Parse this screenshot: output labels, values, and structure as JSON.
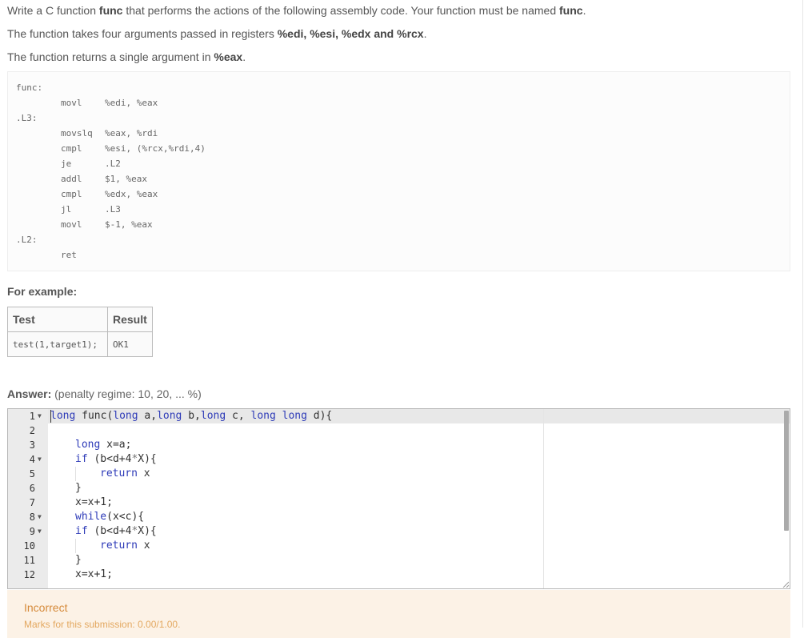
{
  "question": {
    "line1": [
      {
        "t": "Write a C function ",
        "b": false
      },
      {
        "t": "func",
        "b": true
      },
      {
        "t": " that performs the actions of the following assembly code. Your function must be named ",
        "b": false
      },
      {
        "t": "func",
        "b": true
      },
      {
        "t": ".",
        "b": false
      }
    ],
    "line2": [
      {
        "t": "The function takes four arguments passed in registers ",
        "b": false
      },
      {
        "t": "%edi, %esi, %edx and %rcx",
        "b": true
      },
      {
        "t": ".",
        "b": false
      }
    ],
    "line3": [
      {
        "t": "The function returns a single argument in ",
        "b": false
      },
      {
        "t": "%eax",
        "b": true
      },
      {
        "t": ".",
        "b": false
      }
    ]
  },
  "assembly": [
    {
      "label": "func:",
      "op": "",
      "arg": ""
    },
    {
      "label": "",
      "op": "movl",
      "arg": "%edi, %eax"
    },
    {
      "label": ".L3:",
      "op": "",
      "arg": ""
    },
    {
      "label": "",
      "op": "movslq",
      "arg": "%eax, %rdi"
    },
    {
      "label": "",
      "op": "cmpl",
      "arg": "%esi, (%rcx,%rdi,4)"
    },
    {
      "label": "",
      "op": "je",
      "arg": ".L2"
    },
    {
      "label": "",
      "op": "addl",
      "arg": "$1, %eax"
    },
    {
      "label": "",
      "op": "cmpl",
      "arg": "%edx, %eax"
    },
    {
      "label": "",
      "op": "jl",
      "arg": ".L3"
    },
    {
      "label": "",
      "op": "movl",
      "arg": "$-1, %eax"
    },
    {
      "label": ".L2:",
      "op": "",
      "arg": ""
    },
    {
      "label": "",
      "op": "ret",
      "arg": ""
    }
  ],
  "example": {
    "title": "For example:",
    "headers": [
      "Test",
      "Result"
    ],
    "rows": [
      [
        "test(1,target1);",
        "OK1"
      ]
    ]
  },
  "answer": {
    "label": "Answer:",
    "penalty": "(penalty regime: 10, 20, ... %)"
  },
  "editor": {
    "lines": [
      {
        "n": "1",
        "fold": true,
        "indent": 0,
        "tokens": [
          [
            "kw",
            "long"
          ],
          [
            "p",
            " func("
          ],
          [
            "kw",
            "long"
          ],
          [
            "p",
            " a,"
          ],
          [
            "kw",
            "long"
          ],
          [
            "p",
            " b,"
          ],
          [
            "kw",
            "long"
          ],
          [
            "p",
            " c, "
          ],
          [
            "kw",
            "long long"
          ],
          [
            "p",
            " d){"
          ]
        ]
      },
      {
        "n": "2",
        "fold": false,
        "indent": 0,
        "tokens": []
      },
      {
        "n": "3",
        "fold": false,
        "indent": 1,
        "tokens": [
          [
            "kw",
            "long"
          ],
          [
            "p",
            " x=a;"
          ]
        ]
      },
      {
        "n": "4",
        "fold": true,
        "indent": 1,
        "tokens": [
          [
            "kw",
            "if"
          ],
          [
            "p",
            " (b<d+4"
          ],
          [
            "op",
            "*"
          ],
          [
            "p",
            "X){"
          ]
        ]
      },
      {
        "n": "5",
        "fold": false,
        "indent": 2,
        "tokens": [
          [
            "kw",
            "return"
          ],
          [
            "p",
            " x"
          ]
        ]
      },
      {
        "n": "6",
        "fold": false,
        "indent": 1,
        "tokens": [
          [
            "p",
            "}"
          ]
        ]
      },
      {
        "n": "7",
        "fold": false,
        "indent": 1,
        "tokens": [
          [
            "p",
            "x=x+1;"
          ]
        ]
      },
      {
        "n": "8",
        "fold": true,
        "indent": 1,
        "tokens": [
          [
            "kw",
            "while"
          ],
          [
            "p",
            "(x<c){"
          ]
        ]
      },
      {
        "n": "9",
        "fold": true,
        "indent": 1,
        "tokens": [
          [
            "kw",
            "if"
          ],
          [
            "p",
            " (b<d+4"
          ],
          [
            "op",
            "*"
          ],
          [
            "p",
            "X){"
          ]
        ]
      },
      {
        "n": "10",
        "fold": false,
        "indent": 2,
        "tokens": [
          [
            "kw",
            "return"
          ],
          [
            "p",
            " x"
          ]
        ]
      },
      {
        "n": "11",
        "fold": false,
        "indent": 1,
        "tokens": [
          [
            "p",
            "}"
          ]
        ]
      },
      {
        "n": "12",
        "fold": false,
        "indent": 1,
        "tokens": [
          [
            "p",
            "x=x+1;"
          ]
        ]
      }
    ]
  },
  "feedback": {
    "status": "Incorrect",
    "marks": "Marks for this submission: 0.00/1.00."
  }
}
